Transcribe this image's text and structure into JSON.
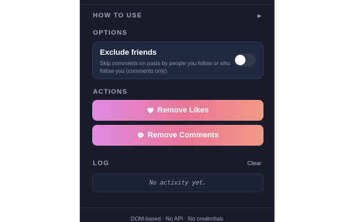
{
  "sections": {
    "how_to_use": "HOW TO USE",
    "options": "OPTIONS",
    "actions": "ACTIONS",
    "log": "LOG"
  },
  "option_exclude_friends": {
    "title": "Exclude friends",
    "description": "Skip comments on posts by people you follow or who follow you (comments only)",
    "enabled": false
  },
  "actions": {
    "remove_likes": "Remove Likes",
    "remove_comments": "Remove Comments"
  },
  "log": {
    "clear_label": "Clear",
    "empty_text": "No activity yet."
  },
  "footer": "DOM-based · No API · No credentials",
  "icons": {
    "expand": "triangle-right-icon",
    "likes": "heart-icon",
    "comments": "speech-bubble-icon"
  },
  "colors": {
    "panel_bg": "#1a1b2b",
    "card_bg": "#1e2840",
    "gradient_start": "#e08ae2",
    "gradient_mid": "#ea7697",
    "gradient_end": "#f19a84"
  }
}
